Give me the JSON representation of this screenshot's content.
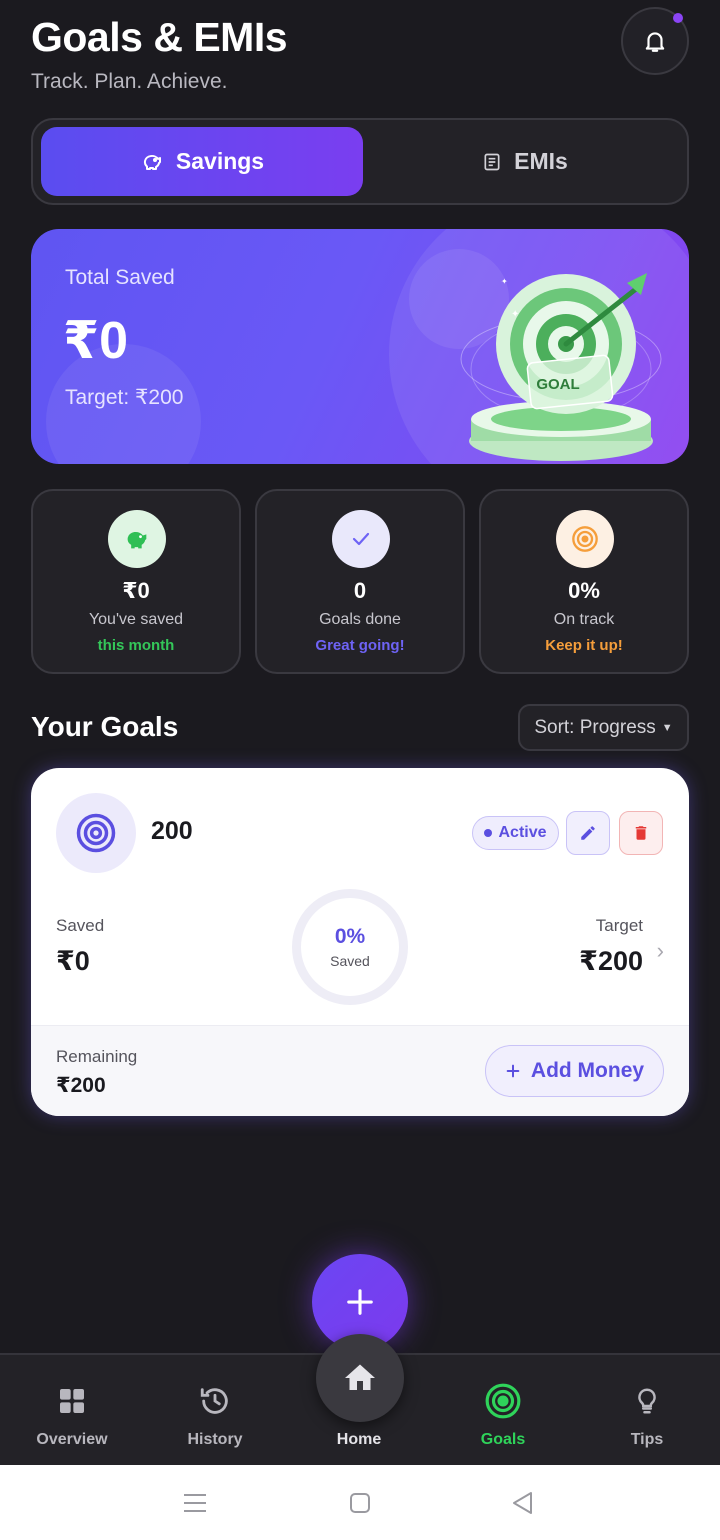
{
  "header": {
    "title": "Goals & EMIs",
    "subtitle": "Track. Plan. Achieve."
  },
  "tabs": [
    {
      "label": "Savings",
      "icon": "piggy-bank-icon",
      "active": true
    },
    {
      "label": "EMIs",
      "icon": "receipt-icon",
      "active": false
    }
  ],
  "hero": {
    "label": "Total Saved",
    "amount": "₹0",
    "target": "Target: ₹200",
    "illustration_text": "GOAL"
  },
  "stats": [
    {
      "value": "₹0",
      "label": "You've saved",
      "note": "this month",
      "note_color": "#34c759",
      "icon": "piggy-bank-icon"
    },
    {
      "value": "0",
      "label": "Goals done",
      "note": "Great going!",
      "note_color": "#6e63f5",
      "icon": "check-icon"
    },
    {
      "value": "0%",
      "label": "On track",
      "note": "Keep it up!",
      "note_color": "#f59e3b",
      "icon": "target-icon"
    }
  ],
  "goals_section": {
    "title": "Your Goals",
    "sort_label": "Sort: Progress"
  },
  "goal": {
    "name": "200",
    "status": "Active",
    "saved_label": "Saved",
    "saved_value": "₹0",
    "progress_pct": "0%",
    "progress_sub": "Saved",
    "target_label": "Target",
    "target_value": "₹200",
    "remaining_label": "Remaining",
    "remaining_value": "₹200",
    "add_money_label": "Add Money"
  },
  "nav": [
    {
      "label": "Overview",
      "icon": "grid-icon",
      "active": false
    },
    {
      "label": "History",
      "icon": "history-icon",
      "active": false
    },
    {
      "label": "Home",
      "icon": "home-icon",
      "active": false
    },
    {
      "label": "Goals",
      "icon": "target-icon",
      "active": true
    },
    {
      "label": "Tips",
      "icon": "bulb-icon",
      "active": false
    }
  ],
  "colors": {
    "accent": "#6b46f3",
    "background": "#1b1a1f",
    "goals_active": "#2fd35a"
  }
}
